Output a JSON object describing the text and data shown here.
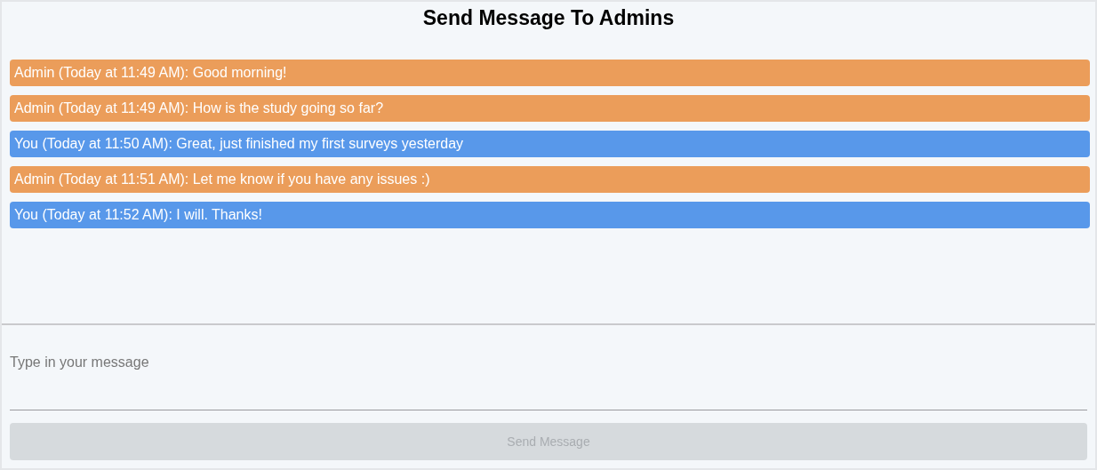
{
  "title": "Send Message To Admins",
  "messages": [
    {
      "text": "Admin (Today at 11:49 AM): Good morning!",
      "color": "#eb9d5a"
    },
    {
      "text": "Admin (Today at 11:49 AM): How is the study going so far?",
      "color": "#eb9d5a"
    },
    {
      "text": "You (Today at 11:50 AM): Great, just finished my first surveys yesterday",
      "color": "#5898ea"
    },
    {
      "text": "Admin (Today at 11:51 AM): Let me know if you have any issues :)",
      "color": "#eb9d5a"
    },
    {
      "text": "You (Today at 11:52 AM): I will. Thanks!",
      "color": "#5898ea"
    }
  ],
  "message_field": {
    "placeholder": "Type in your message"
  },
  "send_button": {
    "label": "Send Message",
    "disabled": true
  }
}
